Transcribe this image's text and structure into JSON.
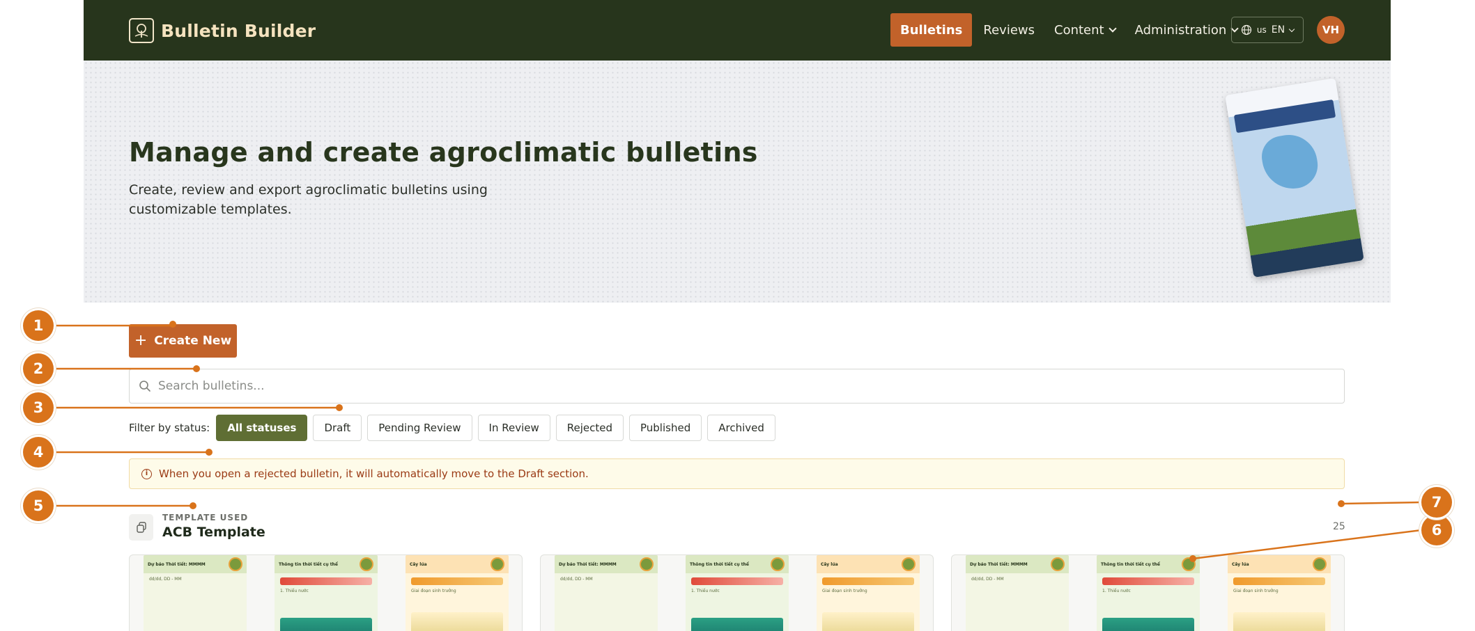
{
  "header": {
    "brand_name": "Bulletin Builder",
    "nav": [
      {
        "label": "Bulletins",
        "active": true,
        "has_menu": false
      },
      {
        "label": "Reviews",
        "active": false,
        "has_menu": false
      },
      {
        "label": "Content",
        "active": false,
        "has_menu": true
      },
      {
        "label": "Administration",
        "active": false,
        "has_menu": true
      }
    ],
    "language_flag": "us",
    "language_label": "EN",
    "user_initials": "VH",
    "colors": {
      "bar": "#27351c",
      "accent": "#c2622a",
      "brand_text": "#f5e3bf"
    }
  },
  "hero": {
    "title": "Manage and create agroclimatic bulletins",
    "subtitle": "Create, review and export agroclimatic bulletins using customizable templates."
  },
  "actions": {
    "create_label": "Create New",
    "create_icon": "plus-icon"
  },
  "search": {
    "placeholder": "Search bulletins...",
    "value": ""
  },
  "filters": {
    "label": "Filter by status:",
    "options": [
      "All statuses",
      "Draft",
      "Pending Review",
      "In Review",
      "Rejected",
      "Published",
      "Archived"
    ],
    "selected": "All statuses",
    "active_color": "#5f6e34"
  },
  "notice": {
    "icon": "info-icon",
    "text": "When you open a rejected bulletin, it will automatically move to the Draft section."
  },
  "template_group": {
    "caption": "TEMPLATE USED",
    "name": "ACB Template",
    "count": "25",
    "icon": "copy-icon"
  },
  "bulletins": [
    {
      "pages": [
        {
          "title": "Dự báo Thời tiết: MMMM",
          "kind": "forecast",
          "line": "dd/dd, DD - MM"
        },
        {
          "title": "Thông tin thời tiết cụ thể",
          "kind": "hydro",
          "line": "1. Thiếu nước"
        },
        {
          "title": "Cây lúa",
          "kind": "crop",
          "line": "Giai đoạn sinh trưởng"
        }
      ]
    },
    {
      "pages": [
        {
          "title": "Dự báo Thời tiết: MMMM",
          "kind": "forecast",
          "line": "dd/dd, DD - MM"
        },
        {
          "title": "Thông tin thời tiết cụ thể",
          "kind": "hydro",
          "line": "1. Thiếu nước"
        },
        {
          "title": "Cây lúa",
          "kind": "crop",
          "line": "Giai đoạn sinh trưởng"
        }
      ]
    },
    {
      "pages": [
        {
          "title": "Dự báo Thời tiết: MMMM",
          "kind": "forecast",
          "line": "dd/dd, DD - MM"
        },
        {
          "title": "Thông tin thời tiết cụ thể",
          "kind": "hydro",
          "line": "1. Thiếu nước"
        },
        {
          "title": "Cây lúa",
          "kind": "crop",
          "line": "Giai đoạn sinh trưởng"
        }
      ]
    }
  ],
  "tour_markers": [
    "1",
    "2",
    "3",
    "4",
    "5",
    "6",
    "7"
  ]
}
